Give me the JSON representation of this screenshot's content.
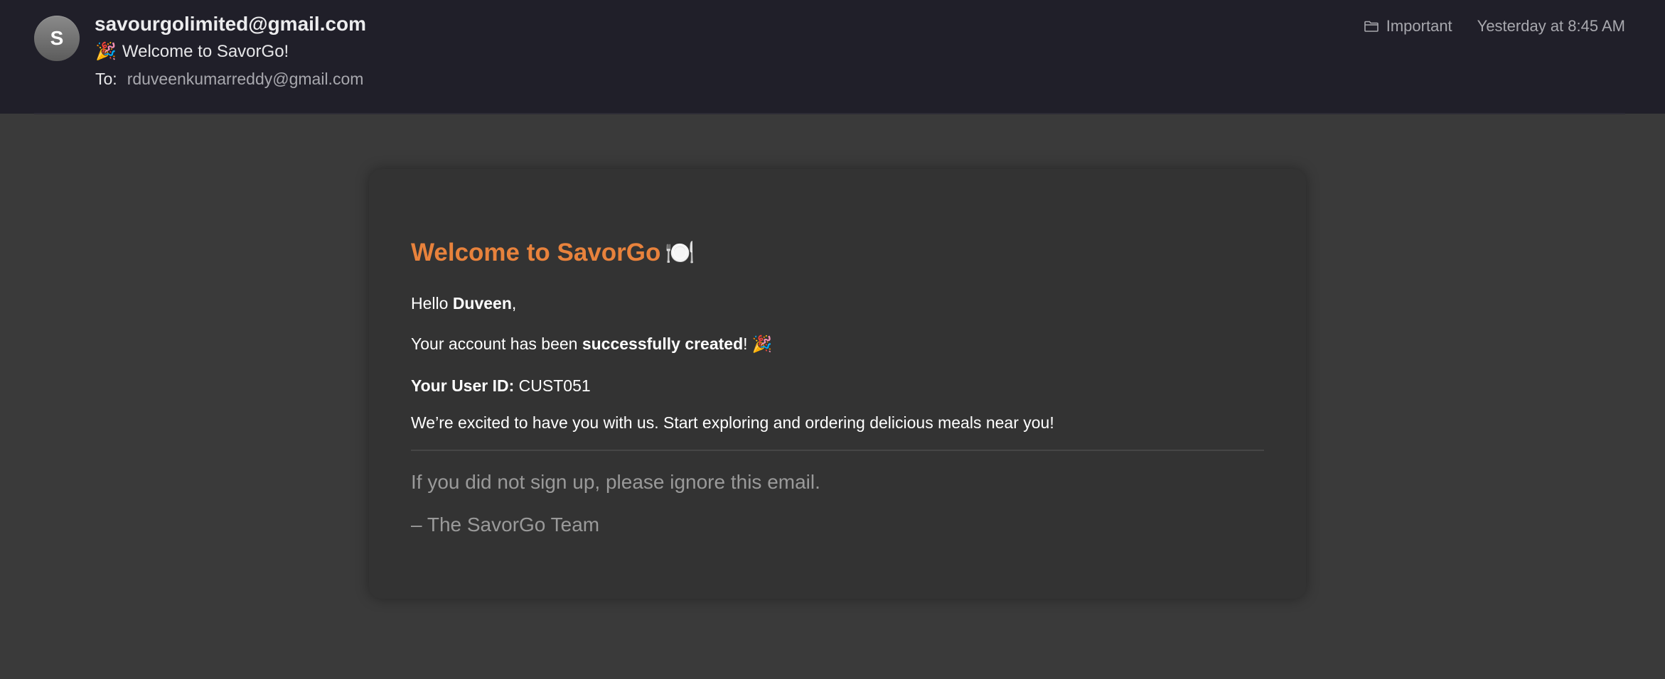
{
  "email": {
    "avatar_initial": "S",
    "sender": "savourgolimited@gmail.com",
    "subject_emoji": "🎉",
    "subject": "Welcome to SavorGo!",
    "to_label": "To:",
    "to_address": "rduveenkumarreddy@gmail.com",
    "folder_icon": "folder-icon",
    "folder_label": "Important",
    "timestamp": "Yesterday at 8:45 AM"
  },
  "body": {
    "heading": "Welcome to SavorGo",
    "heading_emoji": "🍽️",
    "hello_prefix": "Hello ",
    "hello_name": "Duveen",
    "hello_suffix": ",",
    "account_prefix": "Your account has been ",
    "account_bold": "successfully created",
    "account_suffix": "! 🎉",
    "userid_label": "Your User ID:",
    "userid_value": " CUST051",
    "excited": "We’re excited to have you with us. Start exploring and ordering delicious meals near you!",
    "ignore_note": "If you did not sign up, please ignore this email.",
    "signature": "– The SavorGo Team"
  },
  "colors": {
    "accent": "#e8823c",
    "header_bg": "#201f29",
    "page_bg": "#3a3a3a",
    "card_bg": "#333333"
  }
}
